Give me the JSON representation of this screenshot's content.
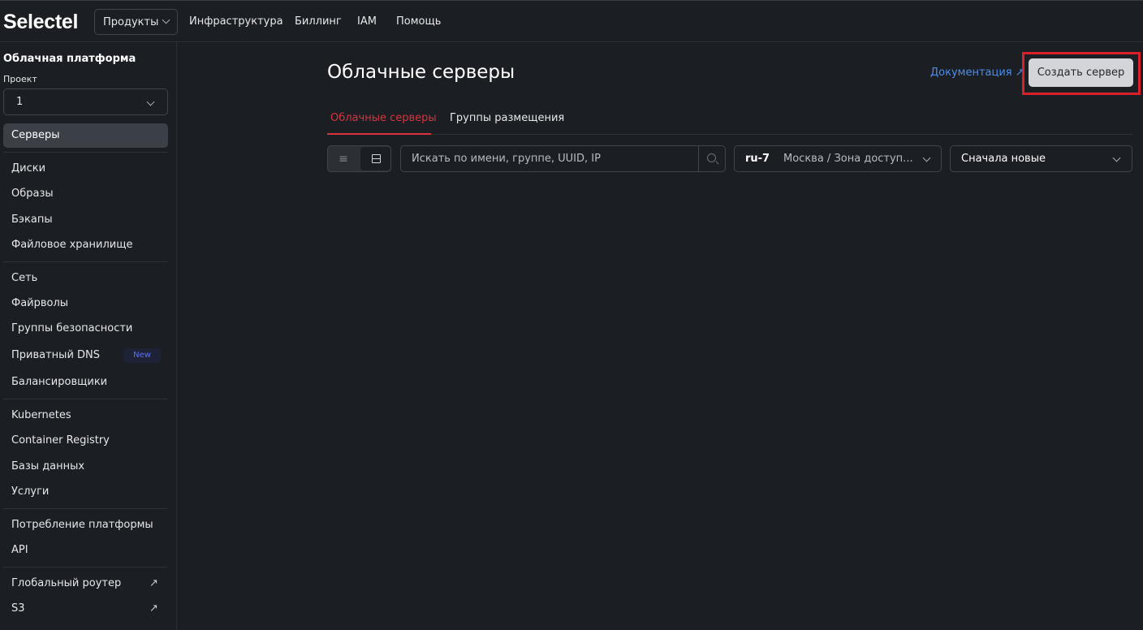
{
  "topbar": {
    "logo": "Selectel",
    "products_label": "Продукты",
    "nav": [
      "Инфраструктура",
      "Биллинг",
      "IAM",
      "Помощь"
    ]
  },
  "sidebar": {
    "title": "Облачная платформа",
    "project_label": "Проект",
    "project_value": "1",
    "active_item": "Серверы",
    "items": [
      "Диски",
      "Образы",
      "Бэкапы",
      "Файловое хранилище",
      "Сеть",
      "Файрволы",
      "Группы безопасности",
      "Приватный DNS",
      "Балансировщики",
      "Kubernetes",
      "Container Registry",
      "Базы данных",
      "Услуги",
      "Потребление платформы",
      "API",
      "Глобальный роутер",
      "S3"
    ],
    "new_badge": "New",
    "external_arrow": "↗"
  },
  "main": {
    "title": "Облачные серверы",
    "doc_link": "Документация ↗",
    "create_button": "Создать сервер",
    "tabs": [
      "Облачные серверы",
      "Группы размещения"
    ],
    "view_list_glyph": "≡",
    "search_placeholder": "Искать по имени, группе, UUID, IP",
    "region_code": "ru-7",
    "region_location": "Москва / Зона доступ...",
    "sort_value": "Сначала новые"
  },
  "colors": {
    "background": "#1b1e22",
    "accent_red": "#d9343d",
    "link_blue": "#4a8ff0",
    "highlight_red": "#d9202a",
    "badge_blue": "#5d6ff0"
  }
}
